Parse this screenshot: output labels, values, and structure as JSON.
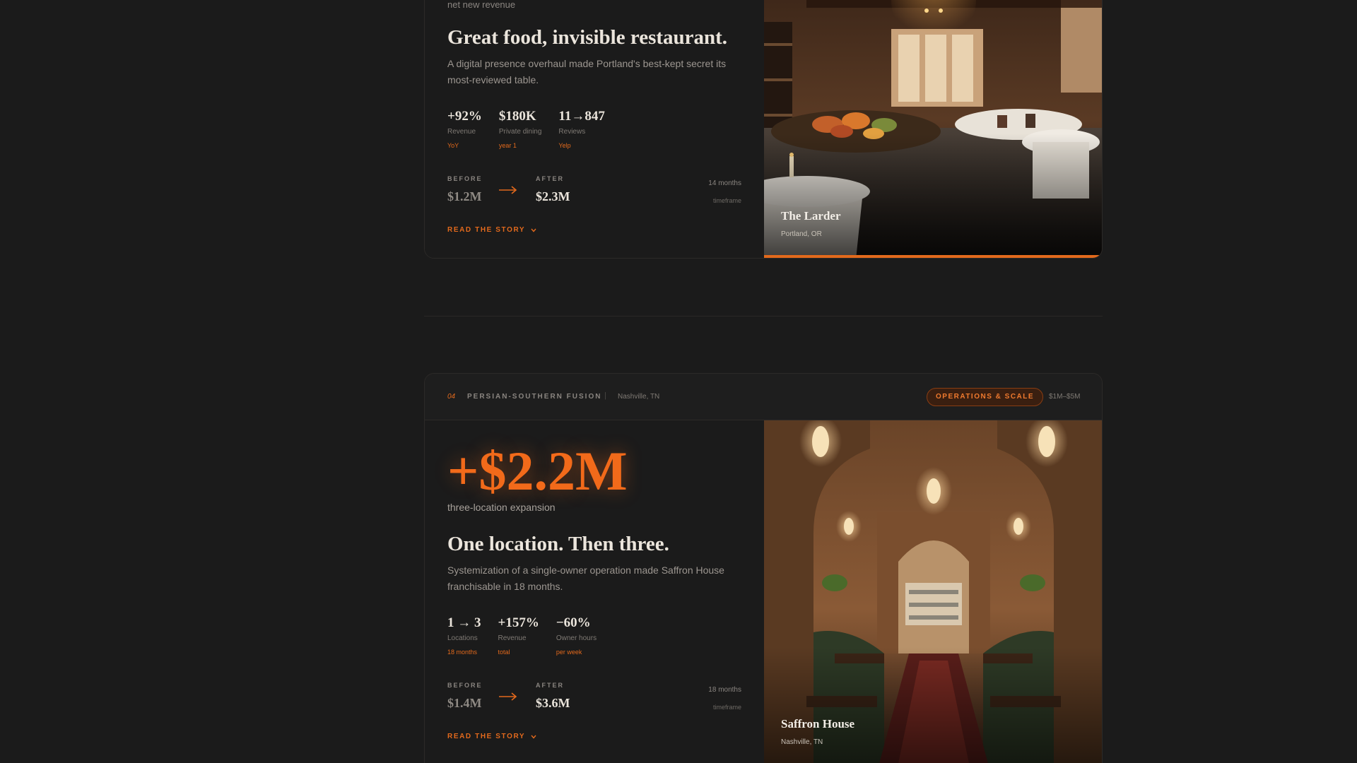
{
  "colors": {
    "accent": "#e2691c",
    "background": "#1b1b1b"
  },
  "icons": {
    "arrow": "long-arrow-right-icon",
    "chevron": "chevron-down-icon"
  },
  "case1": {
    "kicker": "net new revenue",
    "headline": "Great food, invisible restaurant.",
    "description": "A digital presence overhaul made Portland's best-kept secret its most-reviewed table.",
    "metrics": [
      {
        "value": "+92%",
        "label": "Revenue",
        "sub": "YoY"
      },
      {
        "value": "$180K",
        "label": "Private dining",
        "sub": "year 1"
      },
      {
        "value": "11→847",
        "label": "Reviews",
        "sub": "Yelp"
      }
    ],
    "before_label": "BEFORE",
    "before_value": "$1.2M",
    "after_label": "AFTER",
    "after_value": "$2.3M",
    "timeframe": "14 months",
    "timeframe_label": "timeframe",
    "read_story": "READ THE STORY",
    "restaurant": "The Larder",
    "location": "Portland, OR",
    "progress": 1.0
  },
  "case2": {
    "number": "04",
    "category": "PERSIAN-SOUTHERN FUSION",
    "separator": "|",
    "city": "Nashville, TN",
    "badge": "OPERATIONS & SCALE",
    "revenue_range": "$1M–$5M",
    "big_value": "+$2.2M",
    "big_caption": "three-location expansion",
    "headline": "One location. Then three.",
    "description": "Systemization of a single-owner operation made Saffron House franchisable in 18 months.",
    "metrics": [
      {
        "value": "1 → 3",
        "label": "Locations",
        "sub": "18 months"
      },
      {
        "value": "+157%",
        "label": "Revenue",
        "sub": "total"
      },
      {
        "value": "−60%",
        "label": "Owner hours",
        "sub": "per week"
      }
    ],
    "before_label": "BEFORE",
    "before_value": "$1.4M",
    "after_label": "AFTER",
    "after_value": "$3.6M",
    "timeframe": "18 months",
    "timeframe_label": "timeframe",
    "read_story": "READ THE STORY",
    "restaurant": "Saffron House",
    "location": "Nashville, TN"
  }
}
